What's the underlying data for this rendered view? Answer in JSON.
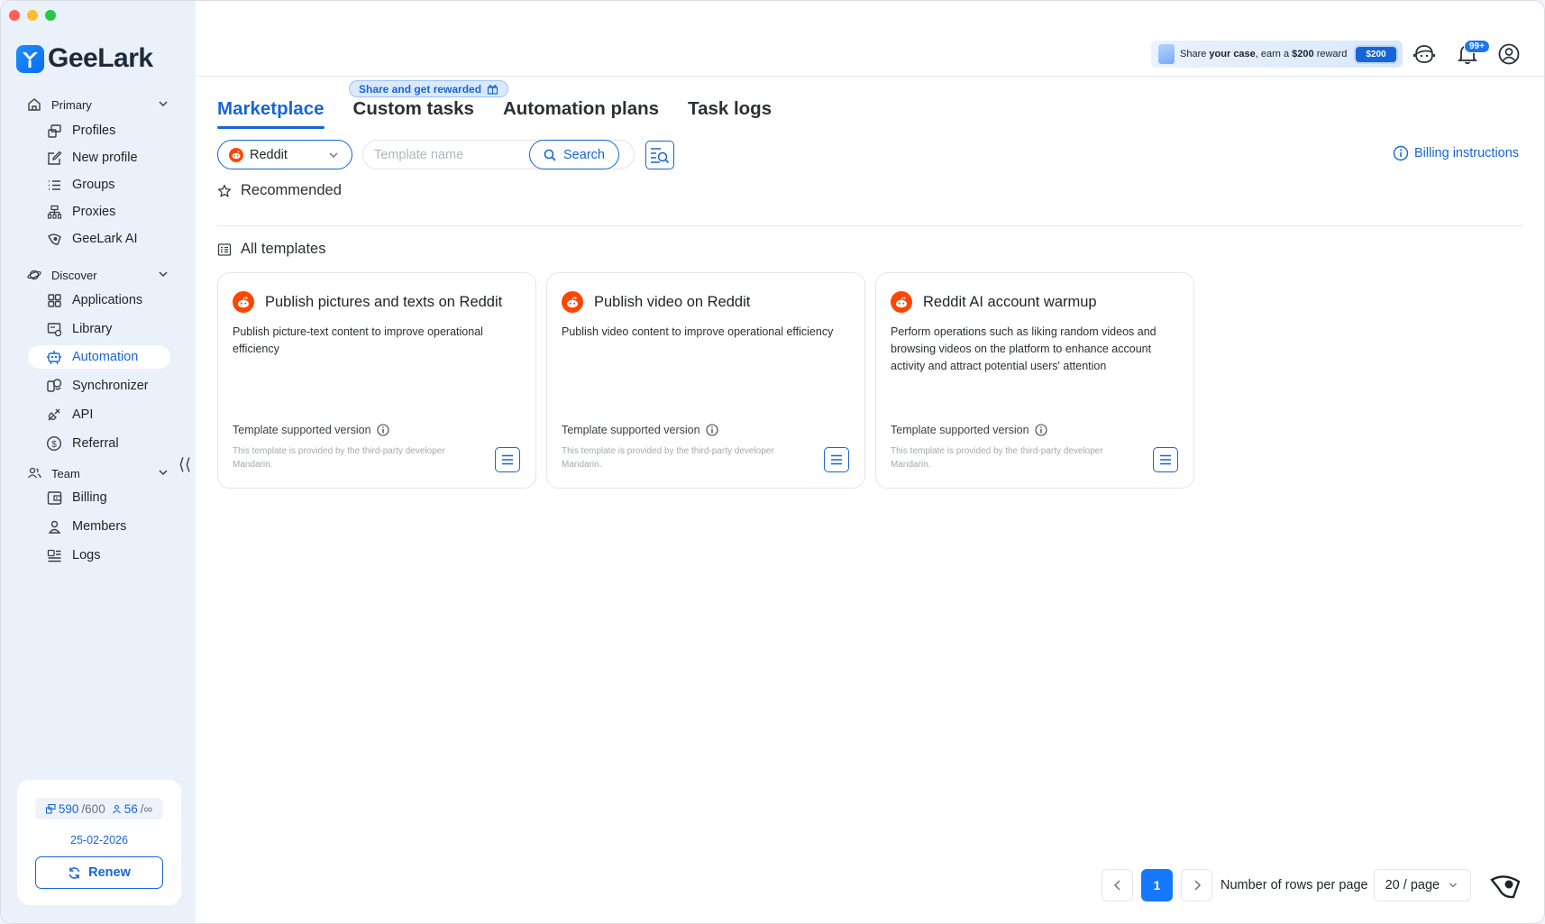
{
  "app": {
    "name": "GeeLark"
  },
  "window_controls": {
    "colors": [
      "#ff5f57",
      "#febc2e",
      "#28c840"
    ]
  },
  "sidebar": {
    "sections": [
      {
        "label": "Primary",
        "icon": "home-icon",
        "items": [
          {
            "label": "Profiles",
            "icon": "profiles-icon"
          },
          {
            "label": "New profile",
            "icon": "edit-icon"
          },
          {
            "label": "Groups",
            "icon": "list-icon"
          },
          {
            "label": "Proxies",
            "icon": "proxy-icon"
          },
          {
            "label": "GeeLark AI",
            "icon": "ai-eye-icon"
          }
        ]
      },
      {
        "label": "Discover",
        "icon": "planet-icon",
        "items": [
          {
            "label": "Applications",
            "icon": "apps-grid-icon"
          },
          {
            "label": "Library",
            "icon": "library-icon"
          },
          {
            "label": "Automation",
            "icon": "robot-icon",
            "active": true
          },
          {
            "label": "Synchronizer",
            "icon": "sync-icon"
          },
          {
            "label": "API",
            "icon": "api-icon"
          },
          {
            "label": "Referral",
            "icon": "dollar-icon"
          }
        ]
      },
      {
        "label": "Team",
        "icon": "team-icon",
        "items": [
          {
            "label": "Billing",
            "icon": "billing-icon"
          },
          {
            "label": "Members",
            "icon": "person-icon"
          },
          {
            "label": "Logs",
            "icon": "logs-icon"
          }
        ]
      }
    ],
    "collapse_glyph": "⟨⟨",
    "plan": {
      "profiles_used": "590",
      "profiles_total": "/600",
      "members_used": "56",
      "members_total": "/∞",
      "expiry": "25-02-2026",
      "renew_label": "Renew"
    }
  },
  "topbar": {
    "promo": {
      "text_pre": "Share ",
      "text_bold": "your case",
      "text_mid": ", earn a ",
      "text_amount": "$200",
      "text_post": " reward",
      "badge": "$200"
    },
    "notifications_badge": "99+",
    "icons": [
      "support-icon",
      "bell-icon",
      "user-account-icon"
    ]
  },
  "tabs": [
    {
      "label": "Marketplace",
      "active": true
    },
    {
      "label": "Custom tasks"
    },
    {
      "label": "Automation plans"
    },
    {
      "label": "Task logs"
    }
  ],
  "share_tag": "Share and get rewarded",
  "filters": {
    "platform": "Reddit",
    "search_placeholder": "Template name",
    "search_button": "Search"
  },
  "billing_link": "Billing instructions",
  "sections": {
    "recommended": "Recommended",
    "all_templates": "All templates"
  },
  "templates": [
    {
      "title": "Publish pictures and texts on Reddit",
      "description": "Publish picture-text content to improve operational efficiency",
      "version_label": "Template supported version",
      "provider_note": "This template is provided by the third-party developer Mandarin."
    },
    {
      "title": "Publish video on Reddit",
      "description": "Publish video content to improve operational efficiency",
      "version_label": "Template supported version",
      "provider_note": "This template is provided by the third-party developer Mandarin."
    },
    {
      "title": "Reddit AI account warmup",
      "description": "Perform operations such as liking random videos and browsing videos on the platform to enhance account activity and attract potential users' attention",
      "version_label": "Template supported version",
      "provider_note": "This template is provided by the third-party developer Mandarin."
    }
  ],
  "pagination": {
    "current_page": "1",
    "rows_label": "Number of rows per page",
    "rows_value": "20 / page"
  },
  "colors": {
    "accent": "#1665d8",
    "sidebar_bg": "#eaf1fb",
    "reddit": "#ff4500"
  }
}
